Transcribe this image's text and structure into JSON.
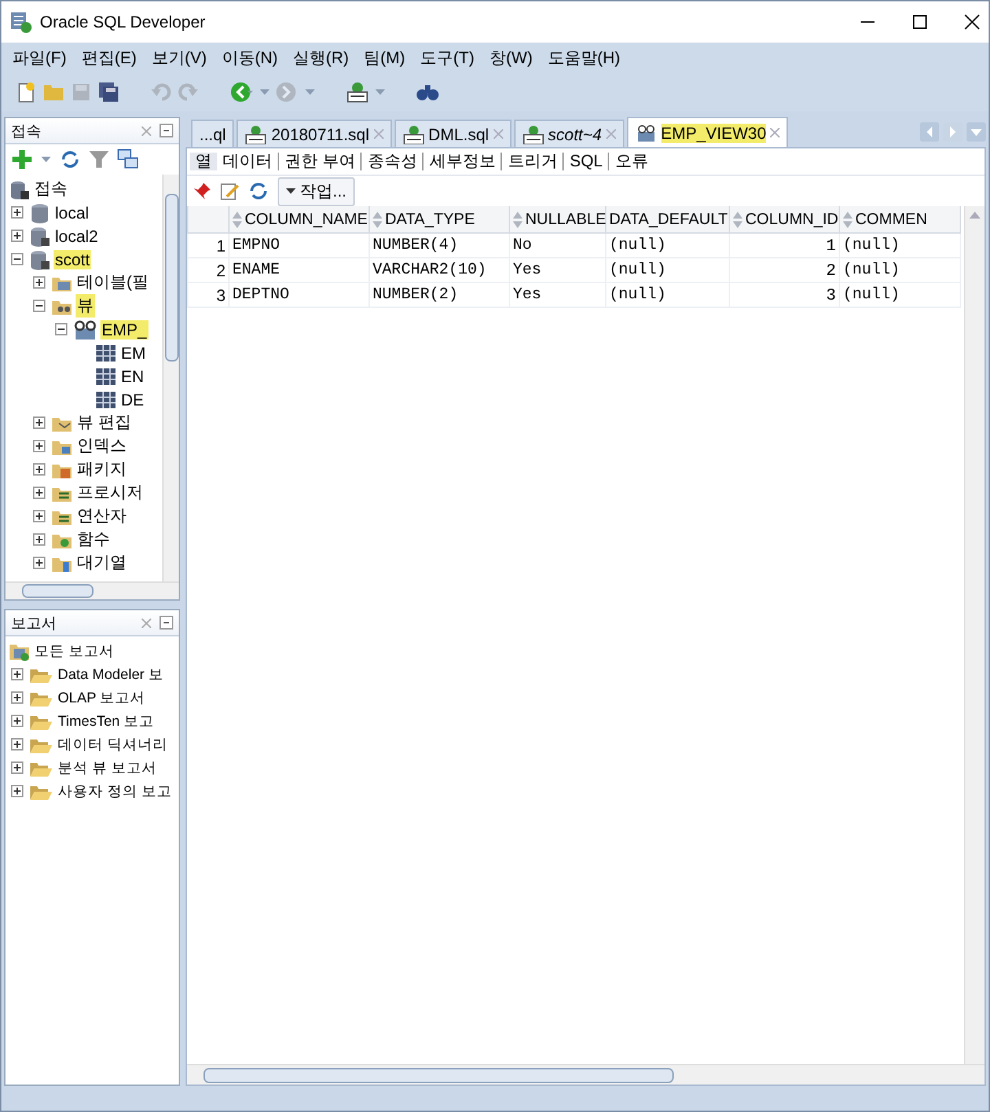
{
  "window": {
    "title": "Oracle SQL Developer"
  },
  "menu": [
    "파일(F)",
    "편집(E)",
    "보기(V)",
    "이동(N)",
    "실행(R)",
    "팀(M)",
    "도구(T)",
    "창(W)",
    "도움말(H)"
  ],
  "toolbar": [
    {
      "kind": "new",
      "disabled": false
    },
    {
      "kind": "open",
      "disabled": false
    },
    {
      "kind": "save",
      "disabled": true
    },
    {
      "kind": "save-all",
      "disabled": false
    },
    {
      "kind": "undo",
      "disabled": true
    },
    {
      "kind": "redo",
      "disabled": true
    },
    {
      "kind": "back",
      "disabled": false
    },
    {
      "kind": "forward",
      "disabled": true
    },
    {
      "kind": "sql",
      "disabled": false
    },
    {
      "kind": "find",
      "disabled": false
    }
  ],
  "connections_panel": {
    "title": "접속",
    "tree": [
      {
        "label": "접속",
        "kind": "connections",
        "highlighted": false,
        "children": [
          {
            "label": "local",
            "kind": "db",
            "expanded": false,
            "highlighted": false
          },
          {
            "label": "local2",
            "kind": "conn",
            "expanded": false,
            "highlighted": false
          },
          {
            "label": "scott",
            "kind": "conn",
            "expanded": true,
            "highlighted": true,
            "children": [
              {
                "label": "테이블(필",
                "kind": "tables",
                "expanded": false,
                "highlighted": false
              },
              {
                "label": "뷰",
                "kind": "views",
                "expanded": true,
                "highlighted": true,
                "children": [
                  {
                    "label": "EMP_",
                    "kind": "view",
                    "expanded": true,
                    "highlighted": true,
                    "children": [
                      {
                        "label": "EM",
                        "kind": "column",
                        "highlighted": false
                      },
                      {
                        "label": "EN",
                        "kind": "column",
                        "highlighted": false
                      },
                      {
                        "label": "DE",
                        "kind": "column",
                        "highlighted": false
                      }
                    ]
                  }
                ]
              },
              {
                "label": "뷰 편집",
                "kind": "editions",
                "expanded": false,
                "highlighted": false
              },
              {
                "label": "인덱스",
                "kind": "indexes",
                "expanded": false,
                "highlighted": false
              },
              {
                "label": "패키지",
                "kind": "packages",
                "expanded": false,
                "highlighted": false
              },
              {
                "label": "프로시저",
                "kind": "procedures",
                "expanded": false,
                "highlighted": false
              },
              {
                "label": "연산자",
                "kind": "procedures",
                "expanded": false,
                "highlighted": false
              },
              {
                "label": "함수",
                "kind": "functions",
                "expanded": false,
                "highlighted": false
              },
              {
                "label": "대기열",
                "kind": "queues",
                "expanded": false,
                "highlighted": false
              }
            ]
          }
        ]
      }
    ]
  },
  "reports_panel": {
    "title": "보고서",
    "tree": [
      {
        "label": "모든 보고서",
        "kind": "reports",
        "highlighted": false,
        "children": [
          {
            "label": "Data Modeler 보",
            "kind": "report-folder",
            "expanded": false,
            "highlighted": false
          },
          {
            "label": "OLAP 보고서",
            "kind": "report-folder",
            "expanded": false,
            "highlighted": false
          },
          {
            "label": "TimesTen 보고",
            "kind": "report-folder",
            "expanded": false,
            "highlighted": false
          },
          {
            "label": "데이터 딕셔너리",
            "kind": "report-folder",
            "expanded": false,
            "highlighted": false
          },
          {
            "label": "분석 뷰 보고서",
            "kind": "report-folder",
            "expanded": false,
            "highlighted": false
          },
          {
            "label": "사용자 정의 보고",
            "kind": "report-folder",
            "expanded": false,
            "highlighted": false
          }
        ]
      }
    ]
  },
  "editor": {
    "tabs": [
      {
        "label": "...ql",
        "kind": "plain",
        "selected": false,
        "italic": false,
        "highlighted": false
      },
      {
        "label": "20180711.sql",
        "kind": "sql",
        "selected": false,
        "italic": false,
        "highlighted": false
      },
      {
        "label": "DML.sql",
        "kind": "sql",
        "selected": false,
        "italic": false,
        "highlighted": false
      },
      {
        "label": "scott~4",
        "kind": "sql",
        "selected": false,
        "italic": true,
        "highlighted": false
      },
      {
        "label": "EMP_VIEW30",
        "kind": "view",
        "selected": true,
        "italic": false,
        "highlighted": true
      }
    ],
    "subtabs": [
      {
        "label": "열",
        "selected": true
      },
      {
        "label": "데이터",
        "selected": false
      },
      {
        "label": "권한 부여",
        "selected": false
      },
      {
        "label": "종속성",
        "selected": false
      },
      {
        "label": "세부정보",
        "selected": false
      },
      {
        "label": "트리거",
        "selected": false
      },
      {
        "label": "SQL",
        "selected": false
      },
      {
        "label": "오류",
        "selected": false
      }
    ],
    "actions_button": "작업...",
    "table": {
      "columns": [
        {
          "label": "COLUMN_NAME",
          "sortable": true
        },
        {
          "label": "DATA_TYPE",
          "sortable": true
        },
        {
          "label": "NULLABLE",
          "sortable": true
        },
        {
          "label": "DATA_DEFAULT",
          "sortable": false
        },
        {
          "label": "COLUMN_ID",
          "sortable": true
        },
        {
          "label": "COMMEN",
          "sortable": true
        }
      ],
      "rows": [
        {
          "number": "1",
          "cells": [
            "EMPNO",
            "NUMBER(4)",
            "No",
            "(null)",
            "1",
            "(null)"
          ]
        },
        {
          "number": "2",
          "cells": [
            "ENAME",
            "VARCHAR2(10)",
            "Yes",
            "(null)",
            "2",
            "(null)"
          ]
        },
        {
          "number": "3",
          "cells": [
            "DEPTNO",
            "NUMBER(2)",
            "Yes",
            "(null)",
            "3",
            "(null)"
          ]
        }
      ]
    }
  }
}
